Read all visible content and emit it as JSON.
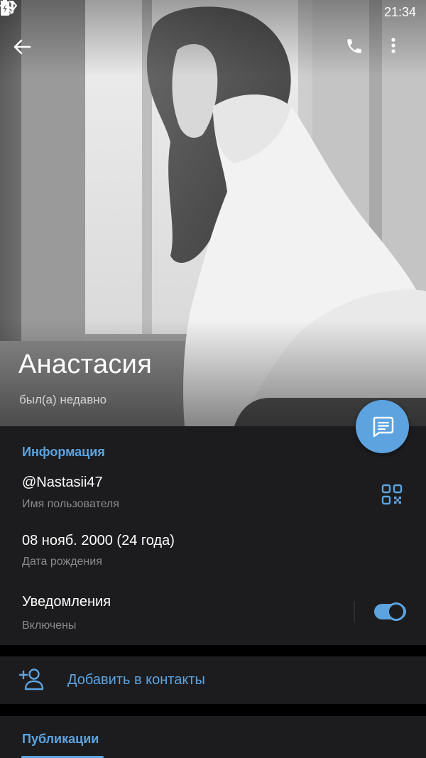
{
  "status_bar": {
    "time": "21:34",
    "left_icons": [
      "telegram-icon",
      "telegram-icon",
      "telegram-icon",
      "image-icon",
      "download-icon"
    ],
    "right_icons": [
      "nfc-icon",
      "no-sim-icon",
      "airplane-icon",
      "battery-icon"
    ]
  },
  "toolbar": {
    "back_icon": "arrow-left-icon",
    "call_icon": "phone-icon",
    "more_icon": "more-vertical-icon"
  },
  "profile": {
    "name": "Анастасия",
    "status": "был(а) недавно"
  },
  "fab_icon": "message-icon",
  "info": {
    "section_title": "Информация",
    "username": "@Nastasii47",
    "username_label": "Имя пользователя",
    "birthday": "08 нояб. 2000 (24 года)",
    "birthday_label": "Дата рождения",
    "notifications": "Уведомления",
    "notifications_state": "Включены",
    "notifications_on": true
  },
  "add_contact": {
    "label": "Добавить в контакты",
    "icon": "add-user-icon"
  },
  "publications": {
    "title": "Публикации"
  },
  "colors": {
    "accent": "#5ca3e0",
    "card": "#1c1c1e",
    "background": "#000000",
    "secondary_text": "#8a8a8e"
  }
}
